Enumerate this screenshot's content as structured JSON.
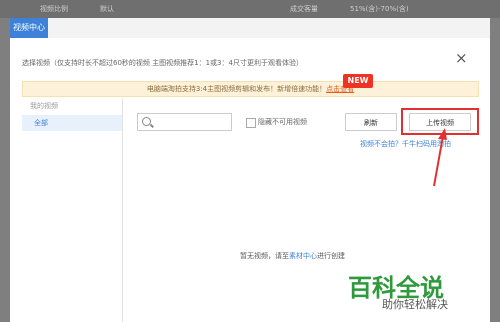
{
  "background": {
    "label_left": "视频比例",
    "value_left": "默认",
    "label_right": "成交客量",
    "value_right": "51%(含)-70%(含)"
  },
  "dialog": {
    "tab_title": "视频中心",
    "hint": "选择视频（仅支持时长不超过60秒的视频 主图视频推荐1：1或3：4尺寸更利于观看体验）",
    "close_icon": "×",
    "banner": {
      "text": "电脑端淘拍支持3:4主图视频剪辑和发布！新增倍速功能！",
      "link": "点击查看",
      "badge": "NEW"
    },
    "sidebar": {
      "title": "我的视频",
      "items": [
        "全部"
      ]
    },
    "search": {
      "placeholder": ""
    },
    "filter": {
      "hide_unavailable": "隐藏不可用视频"
    },
    "buttons": {
      "refresh": "刷新",
      "upload": "上传视频"
    },
    "links": "视频不会拍？千牛扫码用淘拍",
    "empty": {
      "prefix": "暂无视频，请至",
      "link": "素材中心",
      "suffix": "进行创建"
    }
  },
  "watermark": {
    "title": "百科全说",
    "subtitle": "助你轻松解决"
  },
  "colors": {
    "accent": "#3d82d8",
    "highlight": "#e03030",
    "badge": "#ee3324",
    "watermark": "#2e9a3c"
  }
}
